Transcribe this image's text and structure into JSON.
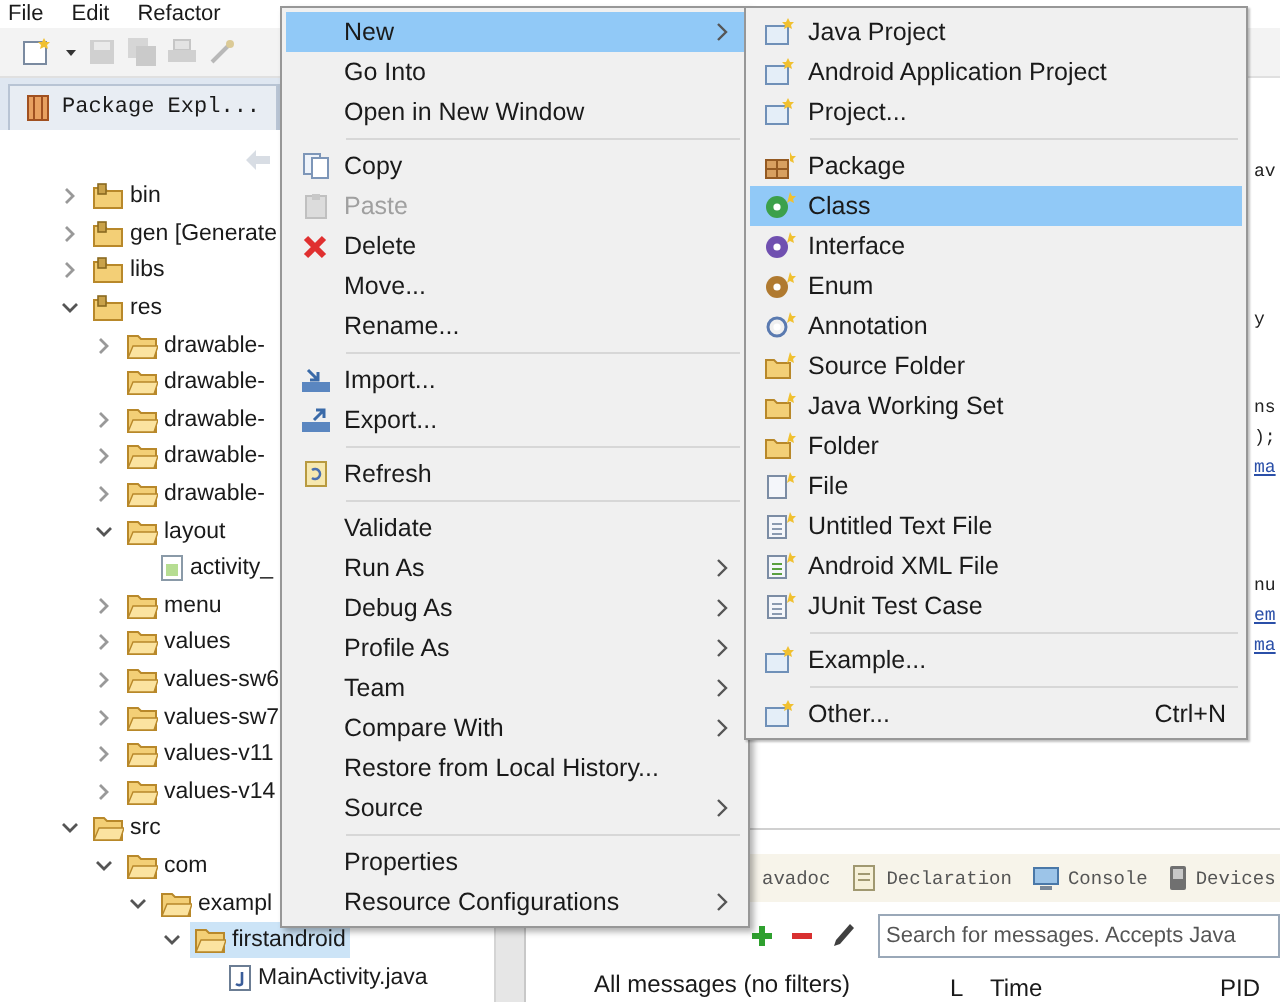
{
  "menu_bar": [
    "File",
    "Edit",
    "Refactor"
  ],
  "explorer_tabs": [
    {
      "label": "Package Expl..."
    }
  ],
  "tree": [
    {
      "label": "bin",
      "kind": "project-folder",
      "expanded": false,
      "selected": false
    },
    {
      "label": "gen [Generate",
      "kind": "project-folder",
      "expanded": false,
      "selected": false
    },
    {
      "label": "libs",
      "kind": "project-folder",
      "expanded": false,
      "selected": false
    },
    {
      "label": "res",
      "kind": "project-folder",
      "expanded": true,
      "selected": false,
      "children": [
        {
          "label": "drawable-",
          "kind": "folder",
          "expanded": false,
          "selected": false
        },
        {
          "label": "drawable-",
          "kind": "empty-folder",
          "selected": false
        },
        {
          "label": "drawable-",
          "kind": "folder",
          "expanded": false,
          "selected": false
        },
        {
          "label": "drawable-",
          "kind": "folder",
          "expanded": false,
          "selected": false
        },
        {
          "label": "drawable-",
          "kind": "folder",
          "expanded": false,
          "selected": false
        },
        {
          "label": "layout",
          "kind": "folder",
          "expanded": true,
          "selected": false,
          "children": [
            {
              "label": "activity_",
              "kind": "xml-file",
              "selected": false
            }
          ]
        },
        {
          "label": "menu",
          "kind": "folder",
          "expanded": false,
          "selected": false
        },
        {
          "label": "values",
          "kind": "folder",
          "expanded": false,
          "selected": false
        },
        {
          "label": "values-sw6",
          "kind": "folder",
          "expanded": false,
          "selected": false
        },
        {
          "label": "values-sw7",
          "kind": "folder",
          "expanded": false,
          "selected": false
        },
        {
          "label": "values-v11",
          "kind": "folder",
          "expanded": false,
          "selected": false
        },
        {
          "label": "values-v14",
          "kind": "folder",
          "expanded": false,
          "selected": false
        }
      ]
    },
    {
      "label": "src",
      "kind": "folder",
      "expanded": true,
      "selected": false,
      "children": [
        {
          "label": "com",
          "kind": "folder",
          "expanded": true,
          "selected": false,
          "children": [
            {
              "label": "exampl",
              "kind": "folder",
              "expanded": true,
              "selected": false,
              "children": [
                {
                  "label": "firstandroid",
                  "kind": "folder",
                  "expanded": true,
                  "selected": true,
                  "children": [
                    {
                      "label": "MainActivity.java",
                      "kind": "java-file",
                      "selected": false
                    }
                  ]
                }
              ]
            }
          ]
        }
      ]
    }
  ],
  "editor": {
    "lines": [
      {
        "text": "av",
        "link": false
      },
      {
        "text": "y",
        "link": false
      },
      {
        "text": "ns",
        "link": false
      },
      {
        "text": ");",
        "link": false
      },
      {
        "text": "ma",
        "link": true
      },
      {
        "text": "nu",
        "link": false
      },
      {
        "text": "em",
        "link": true
      },
      {
        "text": "ma",
        "link": true
      }
    ]
  },
  "context_menu": {
    "groups": [
      [
        {
          "label": "New",
          "submenu": true,
          "selected": true,
          "disabled": false
        },
        {
          "label": "Go Into",
          "submenu": false,
          "selected": false,
          "disabled": false
        },
        {
          "label": "Open in New Window",
          "submenu": false,
          "selected": false,
          "disabled": false
        }
      ],
      [
        {
          "label": "Copy",
          "submenu": false,
          "selected": false,
          "disabled": false
        },
        {
          "label": "Paste",
          "submenu": false,
          "selected": false,
          "disabled": true
        },
        {
          "label": "Delete",
          "submenu": false,
          "selected": false,
          "disabled": false
        },
        {
          "label": "Move...",
          "submenu": false,
          "selected": false,
          "disabled": false
        },
        {
          "label": "Rename...",
          "submenu": false,
          "selected": false,
          "disabled": false
        }
      ],
      [
        {
          "label": "Import...",
          "submenu": false,
          "selected": false,
          "disabled": false
        },
        {
          "label": "Export...",
          "submenu": false,
          "selected": false,
          "disabled": false
        }
      ],
      [
        {
          "label": "Refresh",
          "submenu": false,
          "selected": false,
          "disabled": false
        }
      ],
      [
        {
          "label": "Validate",
          "submenu": false,
          "selected": false,
          "disabled": false
        },
        {
          "label": "Run As",
          "submenu": true,
          "selected": false,
          "disabled": false
        },
        {
          "label": "Debug As",
          "submenu": true,
          "selected": false,
          "disabled": false
        },
        {
          "label": "Profile As",
          "submenu": true,
          "selected": false,
          "disabled": false
        },
        {
          "label": "Team",
          "submenu": true,
          "selected": false,
          "disabled": false
        },
        {
          "label": "Compare With",
          "submenu": true,
          "selected": false,
          "disabled": false
        },
        {
          "label": "Restore from Local History...",
          "submenu": false,
          "selected": false,
          "disabled": false
        },
        {
          "label": "Source",
          "submenu": true,
          "selected": false,
          "disabled": false
        }
      ],
      [
        {
          "label": "Properties",
          "submenu": false,
          "selected": false,
          "disabled": false
        },
        {
          "label": "Resource Configurations",
          "submenu": true,
          "selected": false,
          "disabled": false
        }
      ]
    ]
  },
  "new_submenu": {
    "groups": [
      [
        {
          "label": "Java Project",
          "selected": false
        },
        {
          "label": "Android Application Project",
          "selected": false
        },
        {
          "label": "Project...",
          "selected": false
        }
      ],
      [
        {
          "label": "Package",
          "selected": false
        },
        {
          "label": "Class",
          "selected": true
        },
        {
          "label": "Interface",
          "selected": false
        },
        {
          "label": "Enum",
          "selected": false
        },
        {
          "label": "Annotation",
          "selected": false
        },
        {
          "label": "Source Folder",
          "selected": false
        },
        {
          "label": "Java Working Set",
          "selected": false
        },
        {
          "label": "Folder",
          "selected": false
        },
        {
          "label": "File",
          "selected": false
        },
        {
          "label": "Untitled Text File",
          "selected": false
        },
        {
          "label": "Android XML File",
          "selected": false
        },
        {
          "label": "JUnit Test Case",
          "selected": false
        }
      ],
      [
        {
          "label": "Example...",
          "selected": false
        }
      ],
      [
        {
          "label": "Other...",
          "shortcut": "Ctrl+N",
          "selected": false
        }
      ]
    ]
  },
  "bottom_panel": {
    "tabs": [
      "avadoc",
      "Declaration",
      "Console",
      "Devices"
    ],
    "search": {
      "placeholder": "Search for messages. Accepts Java"
    },
    "filters": [
      "All messages (no filters)"
    ],
    "columns": [
      "L",
      "Time",
      "PID"
    ]
  }
}
